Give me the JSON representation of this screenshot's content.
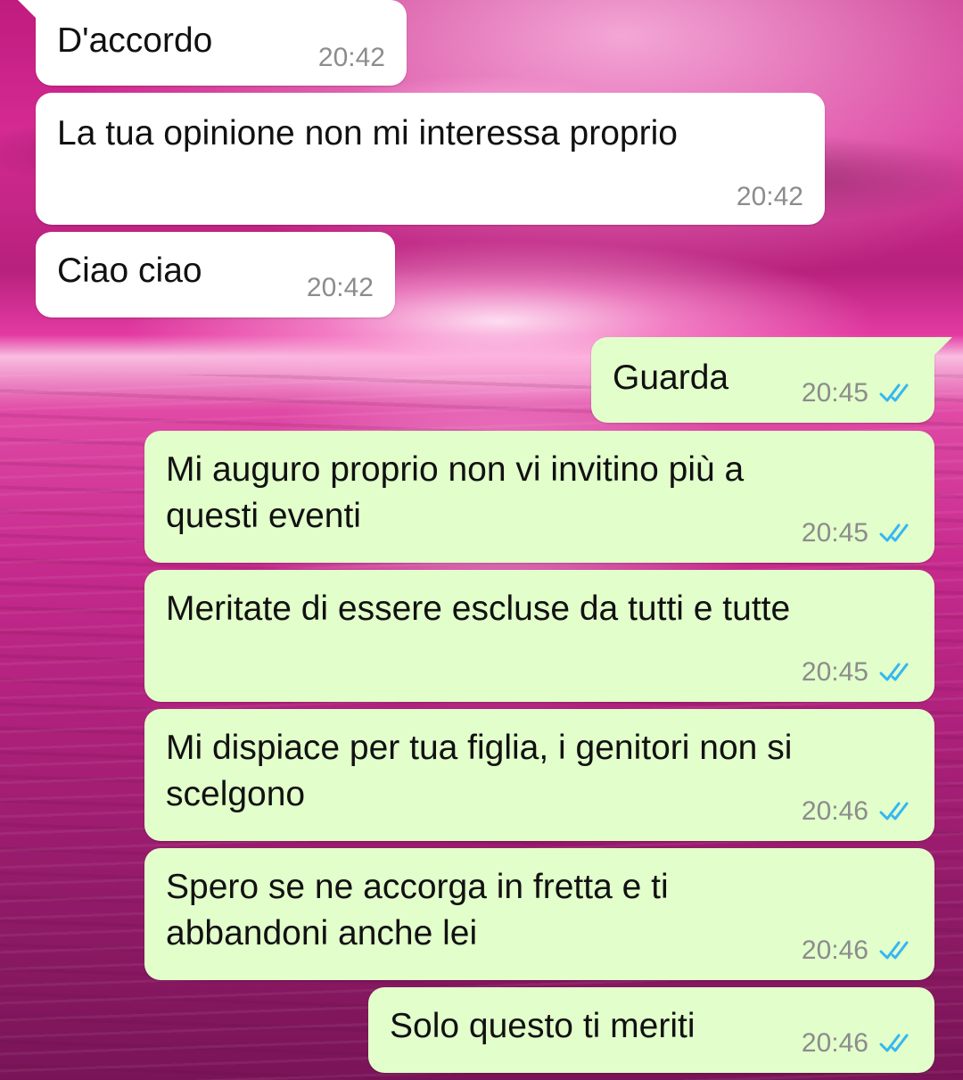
{
  "messages": [
    {
      "direction": "in",
      "text": "D'accordo",
      "time": "20:42"
    },
    {
      "direction": "in",
      "text": "La tua opinione non mi interessa proprio",
      "time": "20:42"
    },
    {
      "direction": "in",
      "text": "Ciao ciao",
      "time": "20:42"
    },
    {
      "direction": "out",
      "text": "Guarda",
      "time": "20:45",
      "status": "read"
    },
    {
      "direction": "out",
      "text": "Mi auguro proprio non vi invitino più a questi eventi",
      "time": "20:45",
      "status": "read"
    },
    {
      "direction": "out",
      "text": "Meritate di essere escluse da tutti e tutte",
      "time": "20:45",
      "status": "read"
    },
    {
      "direction": "out",
      "text": "Mi dispiace per tua figlia, i genitori non si scelgono",
      "time": "20:46",
      "status": "read"
    },
    {
      "direction": "out",
      "text": "Spero se ne accorga in fretta e ti abbandoni anche lei",
      "time": "20:46",
      "status": "read"
    },
    {
      "direction": "out",
      "text": "Solo questo ti meriti",
      "time": "20:46",
      "status": "read"
    }
  ],
  "colors": {
    "incoming_bubble": "#ffffff",
    "outgoing_bubble": "#e2fecb",
    "time_text": "#8c8c8c",
    "read_ticks": "#34b7f1"
  },
  "icons": {
    "read_status": "double-check-icon"
  }
}
